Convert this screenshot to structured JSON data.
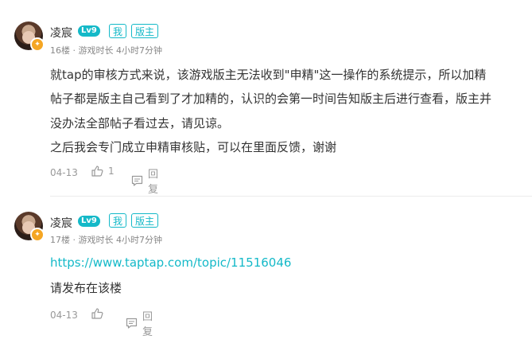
{
  "posts": [
    {
      "author": "凌宸",
      "level": "Lv9",
      "tags": [
        "我",
        "版主"
      ],
      "floor": "16楼",
      "meta_sep": "·",
      "playtime": "游戏时长 4小时7分钟",
      "lines": [
        "就tap的审核方式来说，该游戏版主无法收到\"申精\"这一操作的系统提示，所以加精",
        "帖子都是版主自己看到了才加精的，认识的会第一时间告知版主后进行查看，版主并",
        "没办法全部帖子看过去，请见谅。",
        "之后我会专门成立申精审核贴，可以在里面反馈，谢谢"
      ],
      "date": "04-13",
      "like_count": "1",
      "reply_label": "回复"
    },
    {
      "author": "凌宸",
      "level": "Lv9",
      "tags": [
        "我",
        "版主"
      ],
      "floor": "17楼",
      "meta_sep": "·",
      "playtime": "游戏时长 4小时7分钟",
      "link": "https://www.taptap.com/topic/11516046",
      "lines": [
        "请发布在该楼"
      ],
      "date": "04-13",
      "like_count": "",
      "reply_label": "回复"
    }
  ],
  "colors": {
    "accent": "#14b9c8",
    "badge": "#f5a623",
    "muted": "#999999"
  },
  "icons": {
    "like": "thumbs-up-icon",
    "reply": "comment-icon",
    "avatar_badge": "moderator-badge-icon"
  }
}
